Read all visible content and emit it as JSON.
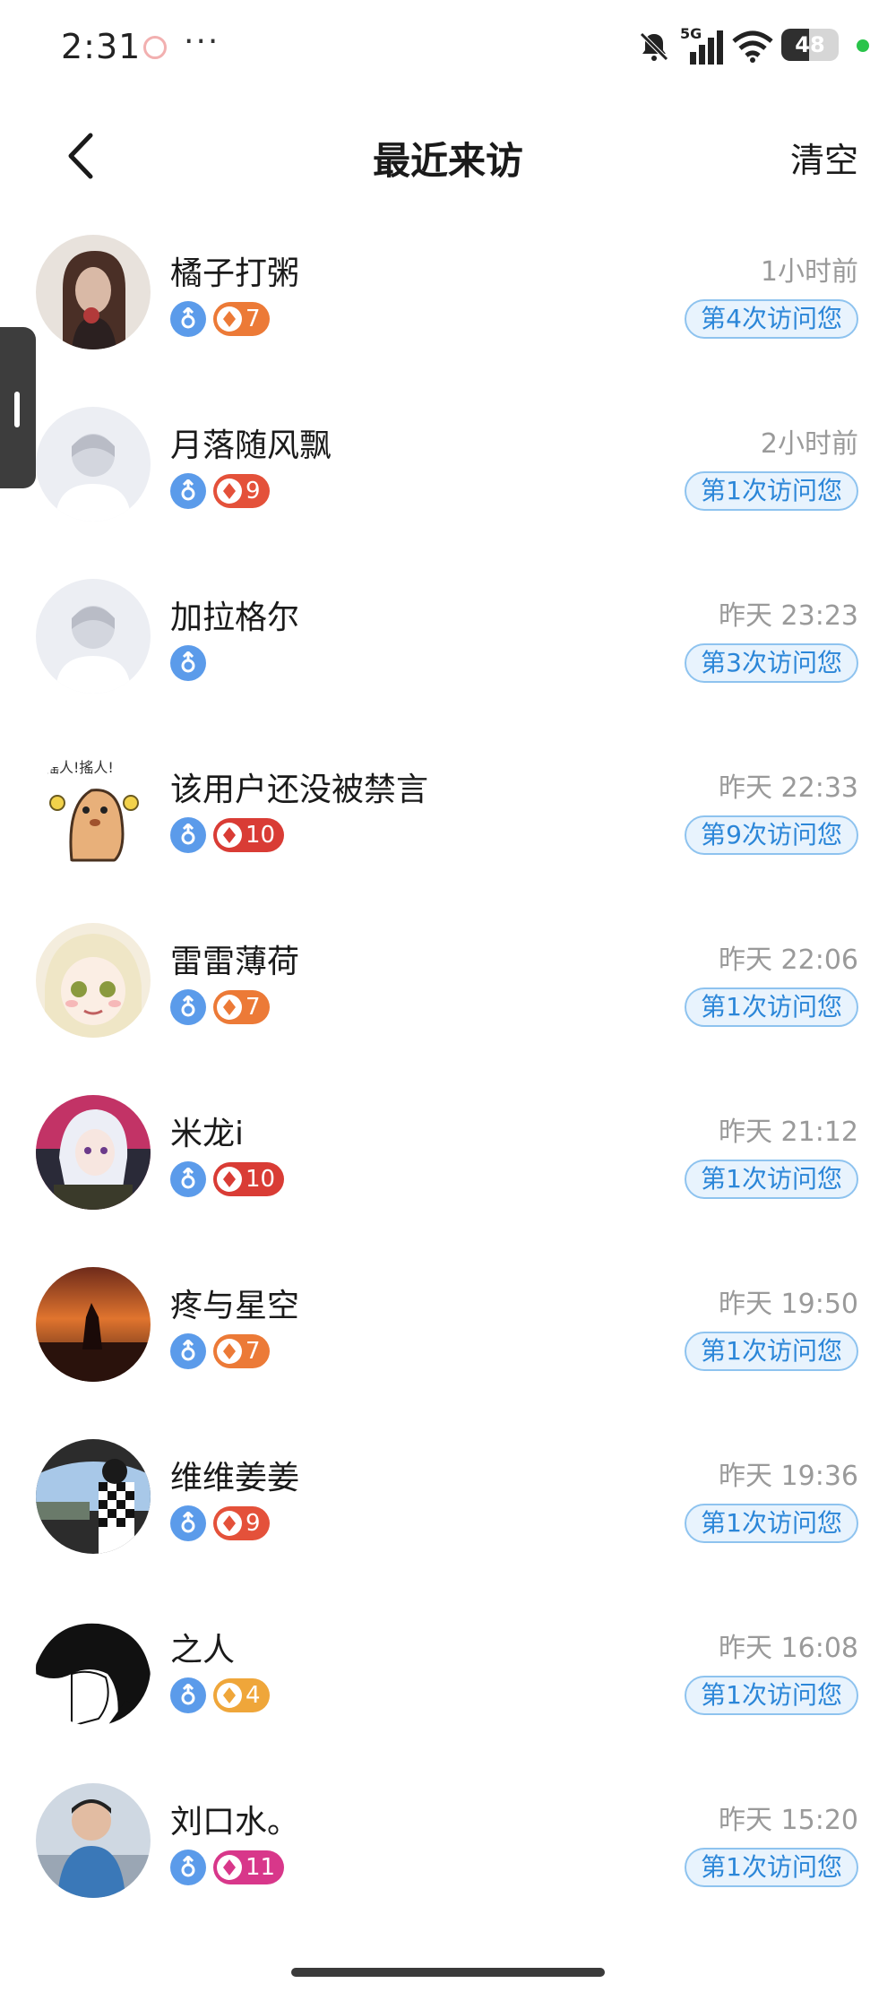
{
  "status_bar": {
    "time": "2:31",
    "more": "···",
    "network": "5G",
    "battery": "48",
    "battery_level": 0.48
  },
  "header": {
    "title": "最近来访",
    "clear_label": "清空"
  },
  "visitors": [
    {
      "name": "橘子打粥",
      "level": "7",
      "level_color": "#ec7a37",
      "time": "1小时前",
      "visit": "第4次访问您",
      "avatar_style": "photo-dark"
    },
    {
      "name": "月落随风飘",
      "level": "9",
      "level_color": "#e4513a",
      "time": "2小时前",
      "visit": "第1次访问您",
      "avatar_style": "default"
    },
    {
      "name": "加拉格尔",
      "level": "",
      "level_color": "",
      "time": "昨天 23:23",
      "visit": "第3次访问您",
      "avatar_style": "default"
    },
    {
      "name": "该用户还没被禁言",
      "level": "10",
      "level_color": "#d93c35",
      "time": "昨天 22:33",
      "visit": "第9次访问您",
      "avatar_style": "cartoon"
    },
    {
      "name": "雷雷薄荷",
      "level": "7",
      "level_color": "#ec7a37",
      "time": "昨天 22:06",
      "visit": "第1次访问您",
      "avatar_style": "anime-light"
    },
    {
      "name": "米龙i",
      "level": "10",
      "level_color": "#d93c35",
      "time": "昨天 21:12",
      "visit": "第1次访问您",
      "avatar_style": "anime-dark"
    },
    {
      "name": "疼与星空",
      "level": "7",
      "level_color": "#ec7a37",
      "time": "昨天 19:50",
      "visit": "第1次访问您",
      "avatar_style": "sunset"
    },
    {
      "name": "维维姜姜",
      "level": "9",
      "level_color": "#e4513a",
      "time": "昨天 19:36",
      "visit": "第1次访问您",
      "avatar_style": "car"
    },
    {
      "name": "之人",
      "level": "4",
      "level_color": "#efa63a",
      "time": "昨天 16:08",
      "visit": "第1次访问您",
      "avatar_style": "sketch"
    },
    {
      "name": "刘口水。",
      "level": "11",
      "level_color": "#d8378a",
      "time": "昨天 15:20",
      "visit": "第1次访问您",
      "avatar_style": "person"
    }
  ]
}
